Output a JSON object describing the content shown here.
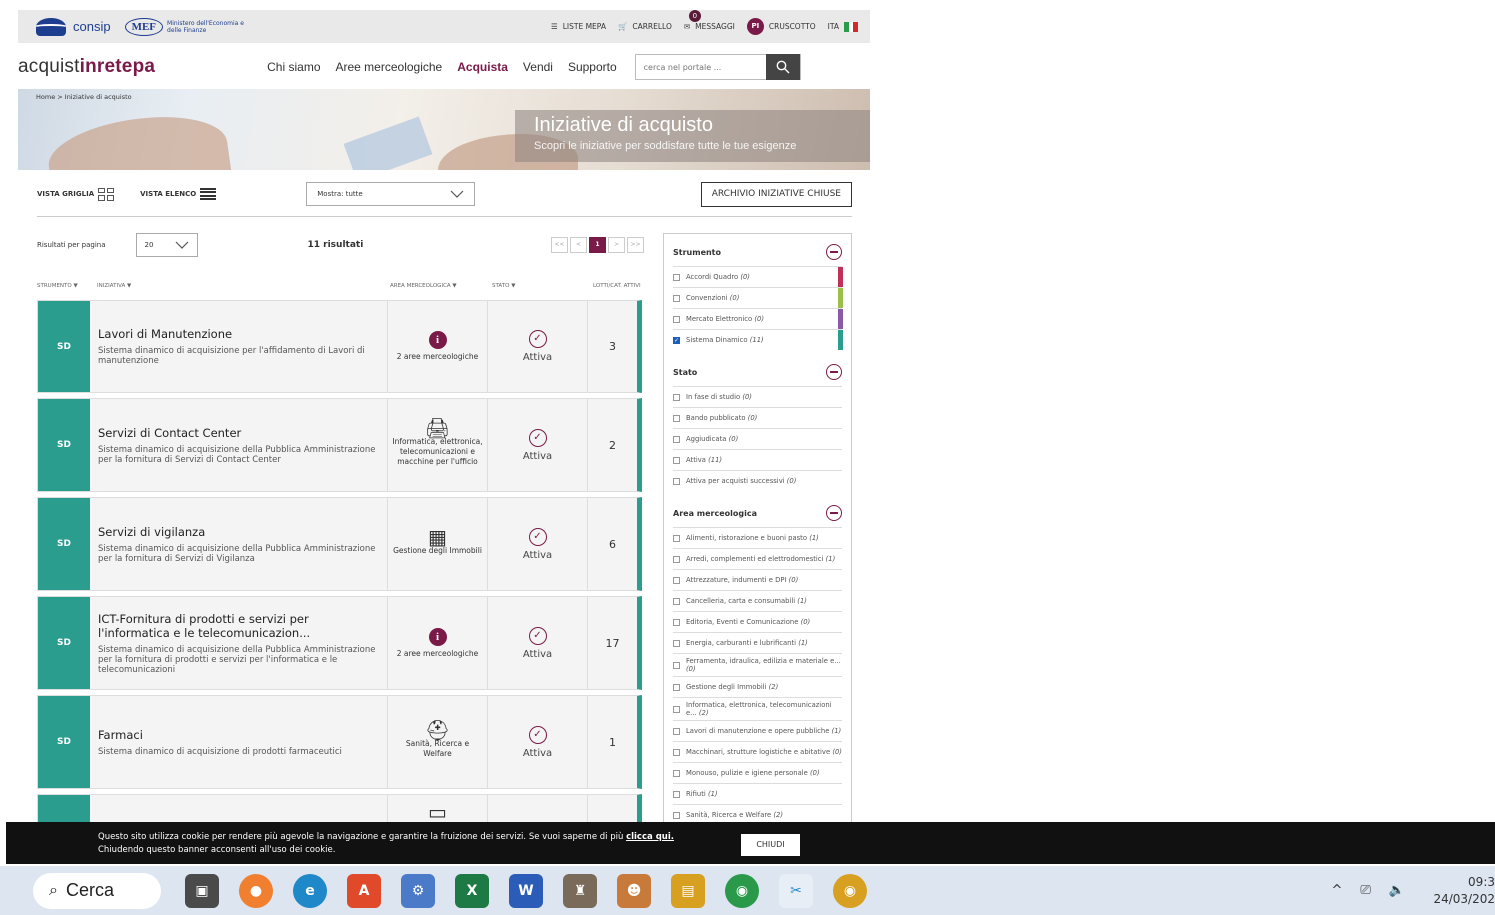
{
  "topbar": {
    "consip": "consip",
    "mef": "MEF",
    "mef_text": "Ministero dell'Economia e delle Finanze",
    "liste_mepa": "LISTE MEPA",
    "carrello": "CARRELLO",
    "messaggi": "MESSAGGI",
    "messaggi_count": "0",
    "user_initials": "PI",
    "cruscotto": "CRUSCOTTO",
    "lang": "ITA"
  },
  "header": {
    "brand_a": "acquist",
    "brand_b": "inrete",
    "brand_c": "pa",
    "nav": [
      "Chi siamo",
      "Aree merceologiche",
      "Acquista",
      "Vendi",
      "Supporto"
    ],
    "search_placeholder": "cerca nel portale ..."
  },
  "hero": {
    "breadcrumb": "Home  >  Iniziative di acquisto",
    "title": "Iniziative di acquisto",
    "subtitle": "Scopri le iniziative per soddisfare tutte le tue esigenze"
  },
  "viewbar": {
    "grid": "VISTA GRIGLIA",
    "list": "VISTA ELENCO",
    "filter": "Mostra: tutte",
    "archive": "ARCHIVIO INIZIATIVE CHIUSE"
  },
  "results": {
    "per_page_label": "Risultati per pagina",
    "per_page_value": "20",
    "count": "11 risultati",
    "pager": [
      "<<",
      "<",
      "1",
      ">",
      ">>"
    ]
  },
  "columns": {
    "strumento": "STRUMENTO ▼",
    "iniziativa": "INIZIATIVA ▼",
    "area": "AREA MERCEOLOGICA ▼",
    "stato": "STATO ▼",
    "lotti": "LOTTI/CAT. ATTIVI"
  },
  "rows": [
    {
      "tag": "SD",
      "title": "Lavori di Manutenzione",
      "desc": "Sistema dinamico di acquisizione per l'affidamento di Lavori di manutenzione",
      "area": "2 aree merceologiche",
      "area_icon": "info-icon",
      "stato": "Attiva",
      "lotti": "3"
    },
    {
      "tag": "SD",
      "title": "Servizi di Contact Center",
      "desc": "Sistema dinamico di acquisizione della Pubblica Amministrazione per la fornitura di Servizi di Contact Center",
      "area": "Informatica, elettronica, telecomunicazioni e macchine per l'ufficio",
      "area_icon": "printer-icon",
      "stato": "Attiva",
      "lotti": "2"
    },
    {
      "tag": "SD",
      "title": "Servizi di vigilanza",
      "desc": "Sistema dinamico di acquisizione della Pubblica Amministrazione per la fornitura di Servizi di Vigilanza",
      "area": "Gestione degli Immobili",
      "area_icon": "building-icon",
      "stato": "Attiva",
      "lotti": "6"
    },
    {
      "tag": "SD",
      "title": "ICT-Fornitura di prodotti e servizi per l'informatica e le telecomunicazion...",
      "desc": "Sistema dinamico di acquisizione della Pubblica Amministrazione per la fornitura di prodotti e servizi per l'informatica e le telecomunicazioni",
      "area": "2 aree merceologiche",
      "area_icon": "info-icon",
      "stato": "Attiva",
      "lotti": "17"
    },
    {
      "tag": "SD",
      "title": "Farmaci",
      "desc": "Sistema dinamico di acquisizione di prodotti farmaceutici",
      "area": "Sanità, Ricerca e Welfare",
      "area_icon": "medkit-icon",
      "stato": "Attiva",
      "lotti": "1"
    }
  ],
  "filters": {
    "strumento": {
      "title": "Strumento",
      "items": [
        {
          "label": "Accordi Quadro",
          "count": "(0)",
          "checked": false,
          "color": "#c0305a"
        },
        {
          "label": "Convenzioni",
          "count": "(0)",
          "checked": false,
          "color": "#9bbf4a"
        },
        {
          "label": "Mercato Elettronico",
          "count": "(0)",
          "checked": false,
          "color": "#8a5aa8"
        },
        {
          "label": "Sistema Dinamico",
          "count": "(11)",
          "checked": true,
          "color": "#2a9d8f"
        }
      ]
    },
    "stato": {
      "title": "Stato",
      "items": [
        {
          "label": "In fase di studio",
          "count": "(0)"
        },
        {
          "label": "Bando pubblicato",
          "count": "(0)"
        },
        {
          "label": "Aggiudicata",
          "count": "(0)"
        },
        {
          "label": "Attiva",
          "count": "(11)"
        },
        {
          "label": "Attiva per acquisti successivi",
          "count": "(0)"
        }
      ]
    },
    "area": {
      "title": "Area merceologica",
      "items": [
        {
          "label": "Alimenti, ristorazione e buoni pasto",
          "count": "(1)"
        },
        {
          "label": "Arredi, complementi ed elettrodomestici",
          "count": "(1)"
        },
        {
          "label": "Attrezzature, indumenti e DPI",
          "count": "(0)"
        },
        {
          "label": "Cancelleria, carta e consumabili",
          "count": "(1)"
        },
        {
          "label": "Editoria, Eventi e Comunicazione",
          "count": "(0)"
        },
        {
          "label": "Energia, carburanti e lubrificanti",
          "count": "(1)"
        },
        {
          "label": "Ferramenta, idraulica, edilizia e materiale e...",
          "count": "(0)"
        },
        {
          "label": "Gestione degli Immobili",
          "count": "(2)"
        },
        {
          "label": "Informatica, elettronica, telecomunicazioni e...",
          "count": "(2)"
        },
        {
          "label": "Lavori di manutenzione e opere pubbliche",
          "count": "(1)"
        },
        {
          "label": "Macchinari, strutture logistiche e abitative",
          "count": "(0)"
        },
        {
          "label": "Monouso, pulizie e igiene personale",
          "count": "(0)"
        },
        {
          "label": "Rifiuti",
          "count": "(1)"
        },
        {
          "label": "Sanità, Ricerca e Welfare",
          "count": "(2)"
        }
      ]
    }
  },
  "cookie": {
    "line1": "Questo sito utilizza cookie per rendere più agevole la navigazione e garantire la fruizione dei servizi. Se vuoi saperne di più ",
    "link": "clicca qui.",
    "line2": "Chiudendo questo banner acconsenti all'uso dei cookie.",
    "button": "CHIUDI"
  },
  "taskbar": {
    "search": "Cerca",
    "time": "09:3",
    "date": "24/03/202"
  }
}
